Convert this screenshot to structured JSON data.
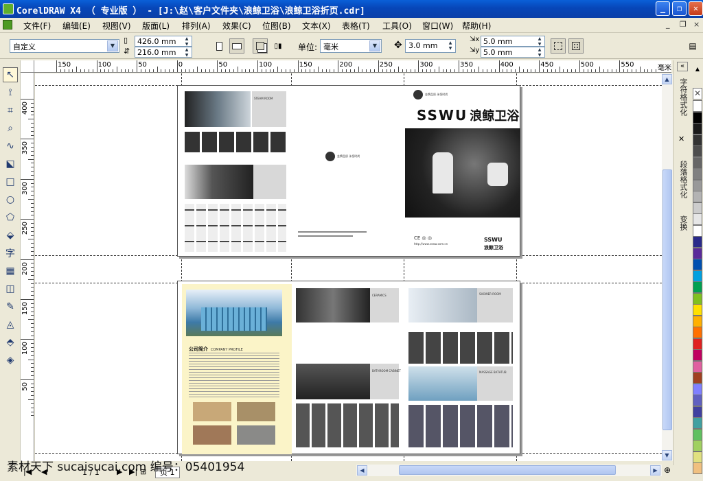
{
  "window": {
    "title": "CorelDRAW X4 （ 专业版 ） - [J:\\赵\\客户文件夹\\浪鲸卫浴\\浪鲸卫浴折页.cdr]",
    "buttons": {
      "minimize": "_",
      "restore": "❐",
      "close": "✕"
    }
  },
  "menu": [
    "文件(F)",
    "编辑(E)",
    "视图(V)",
    "版面(L)",
    "排列(A)",
    "效果(C)",
    "位图(B)",
    "文本(X)",
    "表格(T)",
    "工具(O)",
    "窗口(W)",
    "帮助(H)"
  ],
  "mdi_buttons": [
    "_",
    "❐",
    "×"
  ],
  "property_bar": {
    "paper_preset": "自定义",
    "width": "426.0 mm",
    "height": "216.0 mm",
    "unit_label": "单位:",
    "unit": "毫米",
    "nudge": "3.0 mm",
    "dup_x": "5.0 mm",
    "dup_y": "5.0 mm"
  },
  "ruler": {
    "unit": "毫米",
    "h_labels": [
      "150",
      "100",
      "50",
      "0",
      "50",
      "100",
      "150",
      "200",
      "250",
      "300",
      "350",
      "400",
      "450",
      "500",
      "550"
    ],
    "v_labels": [
      "400",
      "350",
      "300",
      "250",
      "200",
      "150",
      "100",
      "50"
    ]
  },
  "dockers": [
    "字符格式化",
    "段落格式化",
    "变换"
  ],
  "palette_colors": [
    "#ffffff",
    "#000000",
    "#1a1a1a",
    "#333333",
    "#4d4d4d",
    "#666666",
    "#808080",
    "#999999",
    "#b3b3b3",
    "#cccccc",
    "#e6e6e6",
    "#ffffff",
    "#2a2a8a",
    "#5a2a9a",
    "#0050b0",
    "#00a0e0",
    "#00a050",
    "#80c020",
    "#ffe000",
    "#ffb000",
    "#ff7000",
    "#e02020",
    "#c00060",
    "#e060a0",
    "#a04020",
    "#8080ff",
    "#6060c0",
    "#4040a0",
    "#40a0a0",
    "#60c060",
    "#a0d060",
    "#e0e080",
    "#f0c080"
  ],
  "status": {
    "page_count": "1 / 1",
    "page_tab": "页 1"
  },
  "watermark": "素材天下 sucaisucai.com  编号：05401954",
  "document": {
    "brand": "SSWU 浪鲸卫浴",
    "brand_en": "SSWU",
    "brand_cn": "浪鲸卫浴",
    "logo_tag": "金牌品质 永恒时尚",
    "website": "http://www.ssww.com.cn",
    "company_heading": "公司简介",
    "company_heading_en": "COMPANY PROFILE",
    "sections": [
      "STEAM ROOM",
      "SHOWER ROOM",
      "CERAMICS",
      "BATHROOM CABINET",
      "SHOWER ROOM",
      "MASSAGE BATHTUB"
    ]
  }
}
